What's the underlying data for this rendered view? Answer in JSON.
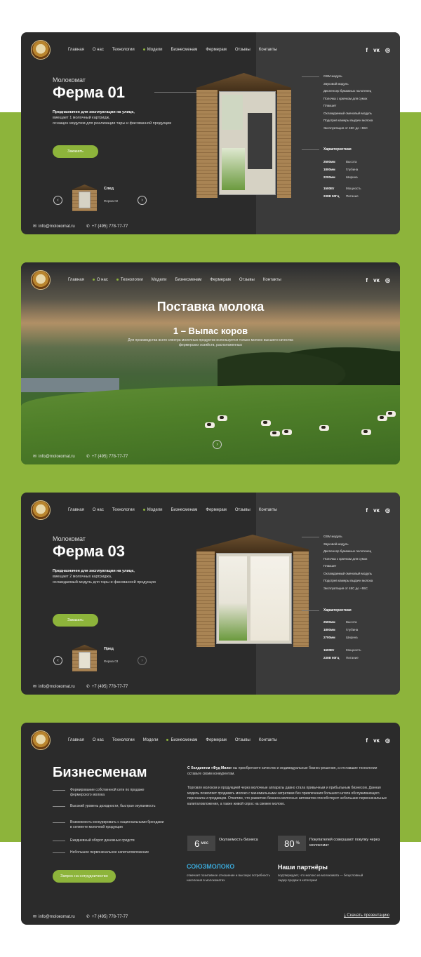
{
  "colors": {
    "accent": "#8db43b",
    "card": "#2b2b2b",
    "panel": "#3a3a3a"
  },
  "nav": {
    "items": [
      "Главная",
      "О нас",
      "Технологии",
      "Модели",
      "Бизнесменам",
      "Фермерам",
      "Отзывы",
      "Контакты"
    ],
    "social": [
      "f",
      "vk",
      "instagram"
    ]
  },
  "footer": {
    "email": "info@moloкomat.ru",
    "phone": "+7 (495) 778-77-77"
  },
  "card1": {
    "subtitle": "Молокомат",
    "title": "Ферма 01",
    "desc_bold": "Предназначен для эксплуатации на улице,",
    "desc_line2": "вмещает 1 молочный картридж,",
    "desc_line3": "оснащен модулем для реализации тары и фасованной продукции",
    "button": "Заказать",
    "next_label": "След",
    "next_model": "Ферма 02",
    "specs": [
      "GSM модуль",
      "Звуковой модуль",
      "Диспенсер бумажных полотенец",
      "Полочка с крючком для сумок",
      "Плакшет",
      "Охлаждаемый сменовый модуль",
      "Подогрев камеры выдачи молока",
      "Эксплуатация от 45С до +55С"
    ],
    "char_head": "Характеристики",
    "chars": [
      [
        "2500мм",
        "Высота"
      ],
      [
        "1800мм",
        "Глубина"
      ],
      [
        "2200мм",
        "Ширина"
      ],
      [
        "1500Вт",
        "Мощность"
      ],
      [
        "230В 50Гц",
        "Питание"
      ]
    ]
  },
  "card2": {
    "title": "Поставка молока",
    "subtitle": "1 – Выпас коров",
    "desc": "Для производства всего спектра молочных продуктов используется только молоко высшего качества фермерских хозяйств, расположенных"
  },
  "card3": {
    "subtitle": "Молокомат",
    "title": "Ферма 03",
    "desc_bold": "Предназначен для эксплуатации на улице,",
    "desc_line2": "вмещает 2 молочных картриджа,",
    "desc_line3": "охлаждаемый модуль для тары и фасованной продукции",
    "button": "Заказать",
    "prev_label": "Пред",
    "prev_model": "Ферма 03",
    "specs": [
      "GSM модуль",
      "Звуковой модуль",
      "Диспенсер бумажных полотенец",
      "Полочка с крючком для сумок",
      "Плакшет",
      "Охлаждаемый сменовый модуль",
      "Подогрев камеры выдачи молока",
      "Эксплуатация от 45С до +55С"
    ],
    "char_head": "Характеристики",
    "chars": [
      [
        "2500мм",
        "Высота"
      ],
      [
        "1800мм",
        "Глубина"
      ],
      [
        "2700мм",
        "Ширина"
      ],
      [
        "1600Вт",
        "Мощность"
      ],
      [
        "230В 50Гц",
        "Питание"
      ]
    ]
  },
  "card4": {
    "title": "Бизнесменам",
    "list": [
      "Формирование собственной сети по продаже фермерского молока",
      "Высокий уровень доходности, быстрая окупаемость",
      "Возможность конкурировать с национальными брендами в сегменте молочной продукции",
      "Ежедневный оборот денежных средств",
      "Небольшое первоначальное капиталовложение"
    ],
    "button": "Запрос на сотрудничество",
    "text1_bold": "С Холдингом «Фуд Милк»",
    "text1": " вы приобретаете качество и индивидуальные бизнес-решения, а отставшие технологии оставьте своим конкурентам.",
    "text2": "Торговля молоком и продукцией через молочные аппараты давно стала привычным и прибыльным бизнесом. Данная модель позволяет продавать молоко с минимальными затратами без привлечения большого штата обслуживающего персонала и продавцов. Отметим, что развитию бизнеса молочных автоматов способствуют небольшие первоначальные капиталовложения, а также живой спрос на свежее молоко.",
    "stat1_value": "6",
    "stat1_unit": "мес",
    "stat1_label": "Окупаемость бизнеса",
    "stat2_value": "80",
    "stat2_unit": "%",
    "stat2_label": "Покупателей совершают покупку через молокомат",
    "partner_logo": "СОЮЗМОЛОКО",
    "partner_text": "отмечает позитивное отношение и высокую потребность населения в молокоматах",
    "partners_head": "Наши партнёры",
    "partners_text": "подтверждает, что молоко из молокомата — безусловный лидер продаж в категории!",
    "download": "Скачать презентацию"
  }
}
